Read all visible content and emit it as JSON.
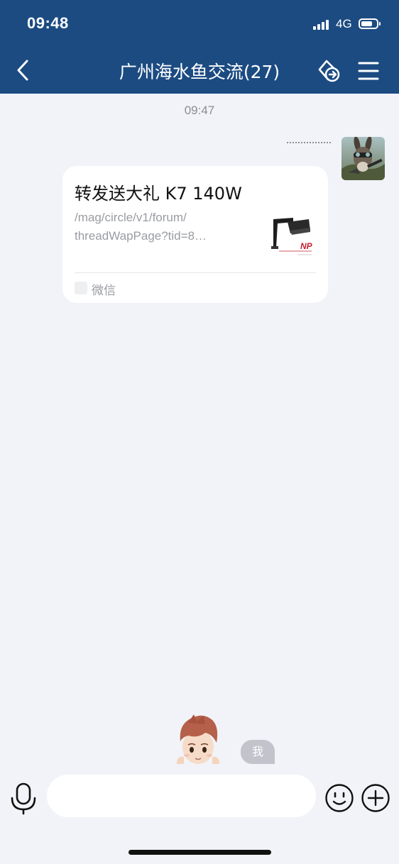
{
  "status_bar": {
    "time": "09:48",
    "network": "4G",
    "signal_bars": 4,
    "battery_level": 0.75
  },
  "header": {
    "title": "广州海水鱼交流(27)",
    "background": "#1c4b82",
    "icons": [
      "chevron-left-icon",
      "share-link-icon",
      "menu-icon"
    ]
  },
  "chat": {
    "timestamp": "09:47",
    "message": {
      "title": "转发送大礼 K7 140W",
      "desc_line1": "/mag/circle/v1/forum/",
      "desc_line2": "threadWapPage?tid=8…",
      "source": "微信",
      "thumb_brand": "NP"
    },
    "me_label": "我"
  },
  "input_bar": {
    "placeholder": "",
    "icons": [
      "microphone-icon",
      "smile-icon",
      "plus-icon"
    ]
  }
}
